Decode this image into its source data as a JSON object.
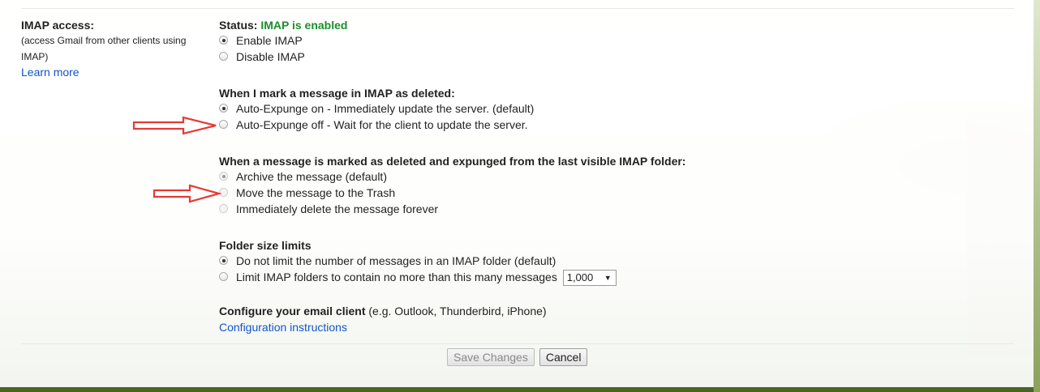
{
  "imap_access": {
    "title": "IMAP access:",
    "description": "(access Gmail from other clients using IMAP)",
    "learn_more": "Learn more"
  },
  "status": {
    "label": "Status:",
    "value": "IMAP is enabled",
    "value_color": "#1a8f2a",
    "options": [
      {
        "label": "Enable IMAP",
        "checked": true
      },
      {
        "label": "Disable IMAP",
        "checked": false
      }
    ]
  },
  "deleted": {
    "heading": "When I mark a message in IMAP as deleted:",
    "options": [
      {
        "label": "Auto-Expunge on - Immediately update the server. (default)",
        "checked": true
      },
      {
        "label": "Auto-Expunge off - Wait for the client to update the server.",
        "checked": false
      }
    ]
  },
  "expunged": {
    "heading": "When a message is marked as deleted and expunged from the last visible IMAP folder:",
    "options": [
      {
        "label": "Archive the message (default)",
        "checked": true
      },
      {
        "label": "Move the message to the Trash",
        "checked": false
      },
      {
        "label": "Immediately delete the message forever",
        "checked": false
      }
    ]
  },
  "folder_size": {
    "heading": "Folder size limits",
    "options": [
      {
        "label": "Do not limit the number of messages in an IMAP folder (default)",
        "checked": true
      },
      {
        "label": "Limit IMAP folders to contain no more than this many messages",
        "checked": false
      }
    ],
    "limit_select_value": "1,000"
  },
  "configure": {
    "heading": "Configure your email client",
    "hint": "(e.g. Outlook, Thunderbird, iPhone)",
    "link": "Configuration instructions"
  },
  "buttons": {
    "save": "Save Changes",
    "cancel": "Cancel"
  },
  "colors": {
    "link": "#1155cc",
    "annotation_arrow": "#e53935"
  },
  "icons": {
    "select_arrow": "▼"
  }
}
